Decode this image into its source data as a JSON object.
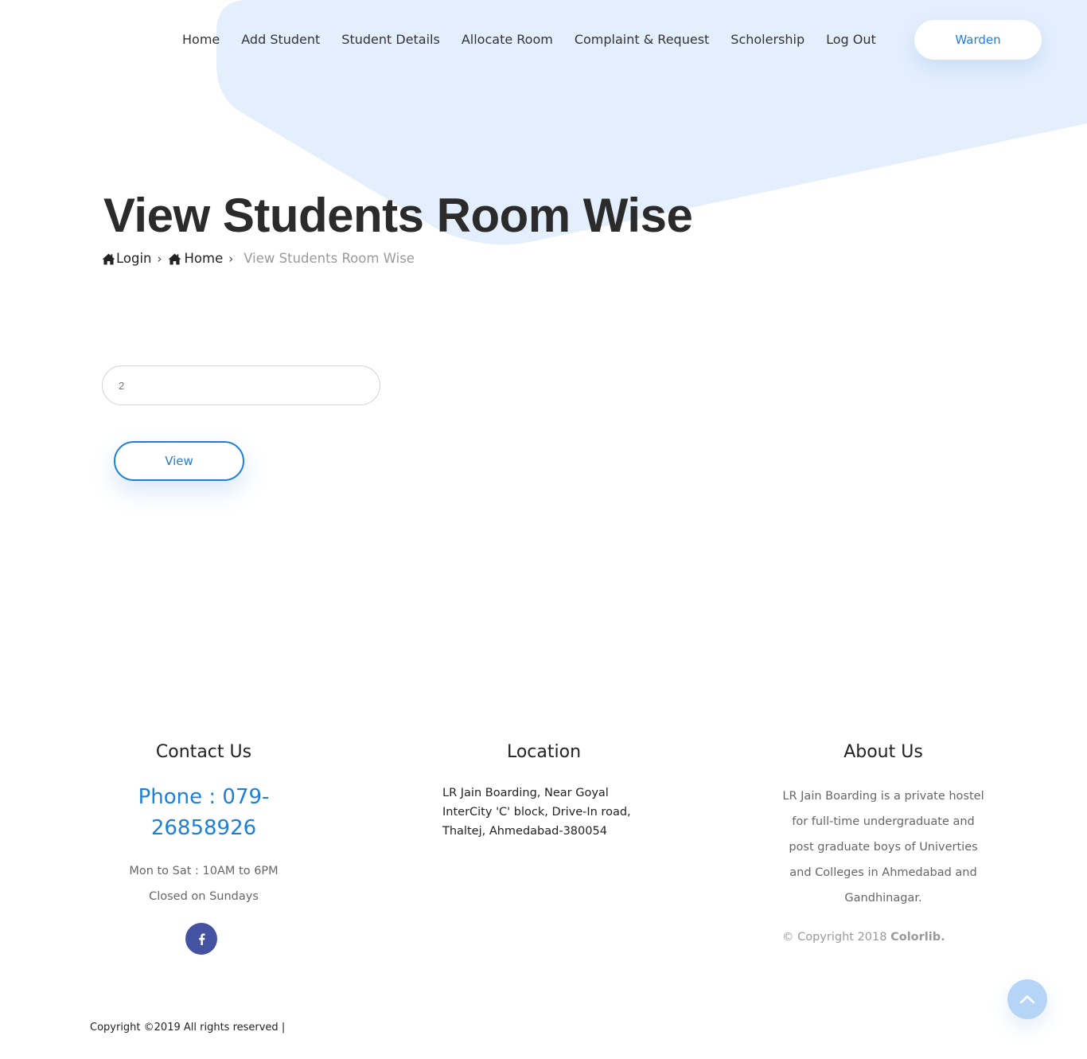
{
  "nav": {
    "items": [
      {
        "label": "Home"
      },
      {
        "label": "Add Student"
      },
      {
        "label": "Student Details"
      },
      {
        "label": "Allocate Room"
      },
      {
        "label": "Complaint & Request"
      },
      {
        "label": "Scholership"
      },
      {
        "label": "Log Out"
      }
    ],
    "user_button": "Warden"
  },
  "header": {
    "title": "View Students Room Wise",
    "breadcrumb": {
      "login": "Login",
      "home": "Home",
      "current": "View Students Room Wise",
      "icons": [
        "home-icon",
        "chevron-right-icon"
      ]
    }
  },
  "form": {
    "room_value": "2",
    "view_label": "View"
  },
  "footer": {
    "contact": {
      "heading": "Contact Us",
      "phone_line1": "Phone : 079-",
      "phone_line2": "26858926",
      "hours_line1": "Mon to Sat : 10AM to 6PM",
      "hours_line2": "Closed on Sundays",
      "social_icon": "facebook-icon"
    },
    "location": {
      "heading": "Location",
      "address_line1": "LR Jain Boarding, Near Goyal",
      "address_line2": "InterCity 'C' block, Drive-In road,",
      "address_line3": "Thaltej, Ahmedabad-380054"
    },
    "about": {
      "heading": "About Us",
      "text_line1": "LR Jain Boarding is a private hostel",
      "text_line2": "for full-time undergraduate and",
      "text_line3": "post graduate boys of Univerties",
      "text_line4": "and Colleges in Ahmedabad and",
      "text_line5": "Gandhinagar.",
      "copyright_prefix": "© Copyright 2018",
      "copyright_brand": "Colorlib."
    },
    "copyright": "Copyright ©2019 All rights reserved |"
  },
  "colors": {
    "accent": "#1e7fd9",
    "hero_shape": "#e4effd",
    "facebook": "#4452a2",
    "scroll_top": "#b5d4f6"
  }
}
